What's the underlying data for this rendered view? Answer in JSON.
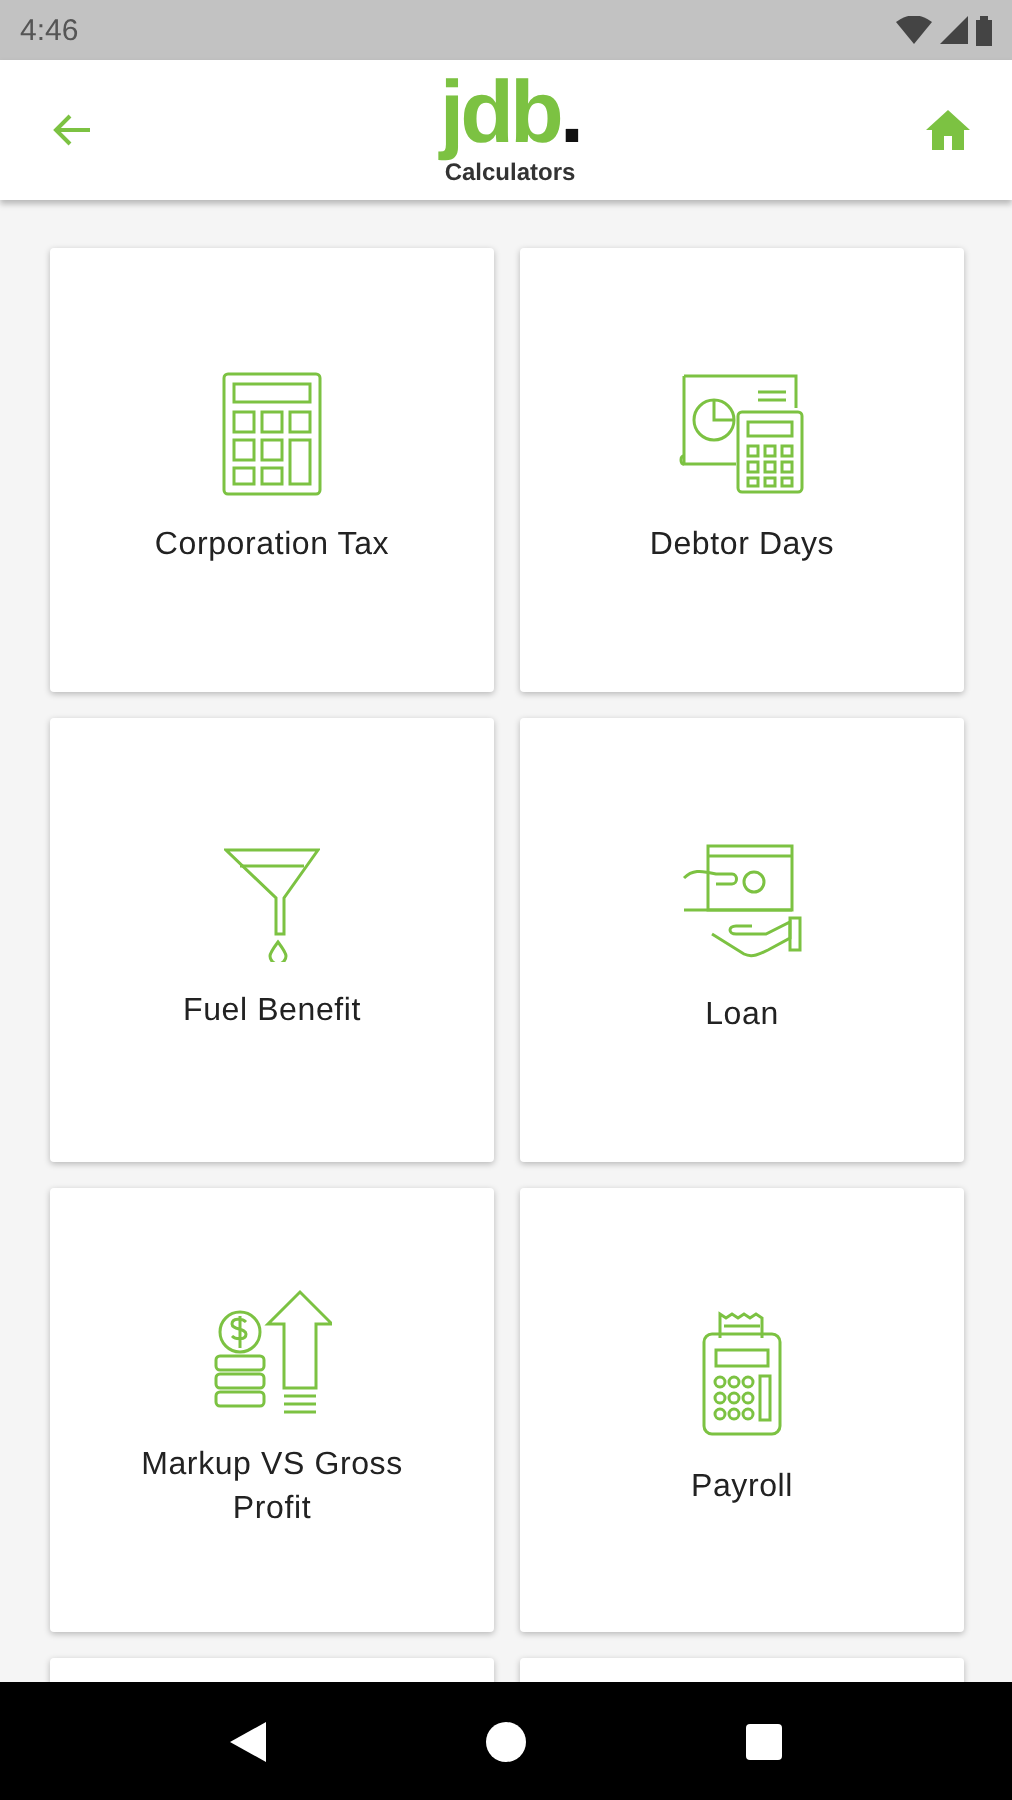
{
  "status_bar": {
    "time": "4:46"
  },
  "app_bar": {
    "logo": {
      "text": "jdb",
      "dot": "."
    },
    "subtitle": "Calculators"
  },
  "calculators": [
    {
      "label": "Corporation Tax"
    },
    {
      "label": "Debtor Days"
    },
    {
      "label": "Fuel Benefit"
    },
    {
      "label": "Loan"
    },
    {
      "label": "Markup VS Gross Profit"
    },
    {
      "label": "Payroll"
    }
  ]
}
